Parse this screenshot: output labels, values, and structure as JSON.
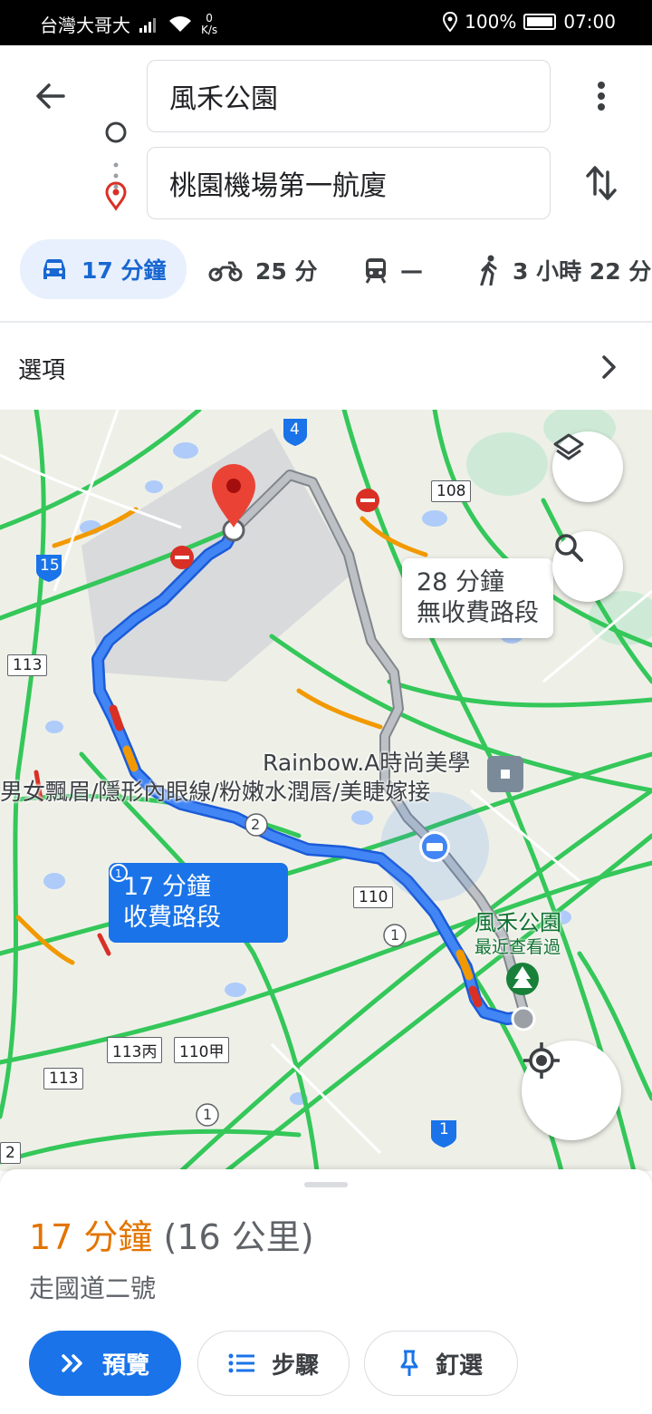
{
  "status_bar": {
    "carrier": "台灣大哥大",
    "net_speed_value": "0",
    "net_speed_unit": "K/s",
    "battery": "100%",
    "time": "07:00"
  },
  "directions": {
    "origin": "風禾公園",
    "destination": "桃園機場第一航廈"
  },
  "modes": [
    {
      "icon": "car-icon",
      "label": "17 分鐘",
      "active": true
    },
    {
      "icon": "motorcycle-icon",
      "label": "25 分"
    },
    {
      "icon": "transit-icon",
      "label": "—"
    },
    {
      "icon": "walk-icon",
      "label": "3 小時 22 分"
    }
  ],
  "options_label": "選項",
  "map": {
    "alt_route_callout": {
      "line1": "28 分鐘",
      "line2": "無收費路段"
    },
    "main_route_callout": {
      "line1": "17 分鐘",
      "line2": "收費路段"
    },
    "poi_name": "Rainbow.A時尚美學",
    "poi_desc": "男女飄眉/隱形內眼線/粉嫩水潤唇/美睫嫁接",
    "park_name": "風禾公園",
    "park_subtitle": "最近查看過",
    "road_shields": [
      "4",
      "108",
      "15",
      "113",
      "110",
      "113丙",
      "110甲",
      "113",
      "2",
      "1",
      "1",
      "2",
      "1"
    ],
    "colors": {
      "route": "#1a73e8",
      "alt_route": "#9aa0a6",
      "traffic_green": "#34c759",
      "traffic_orange": "#f29900",
      "traffic_red": "#d93025"
    }
  },
  "sheet": {
    "eta_time": "17 分鐘",
    "eta_distance": "(16 公里)",
    "via": "走國道二號",
    "btn_preview": "預覽",
    "btn_steps": "步驟",
    "btn_pin": "釘選"
  }
}
